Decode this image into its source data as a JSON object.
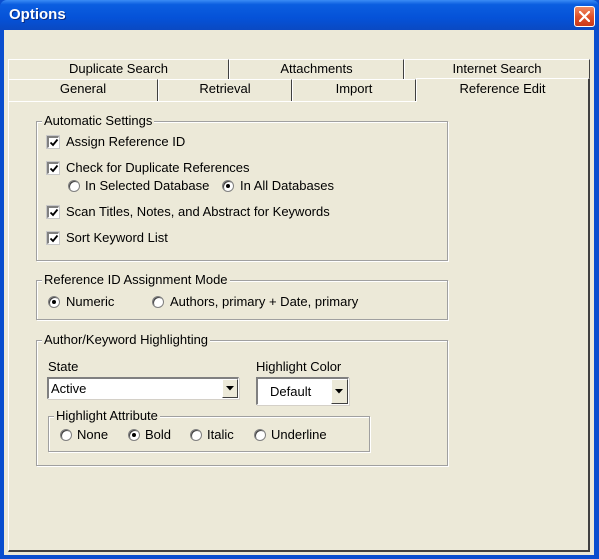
{
  "window": {
    "title": "Options",
    "accent": "#0552d8",
    "close_icon": "close-icon"
  },
  "tabs": {
    "row_back": [
      "Duplicate Search",
      "Attachments",
      "Internet Search"
    ],
    "row_front": [
      "General",
      "Retrieval",
      "Import",
      "Reference Edit"
    ],
    "active": "Reference Edit"
  },
  "automatic_settings": {
    "label": "Automatic Settings",
    "assign_reference_id": {
      "label": "Assign Reference ID",
      "checked": true
    },
    "check_duplicates": {
      "label": "Check for Duplicate References",
      "checked": true
    },
    "in_selected_db": {
      "label": "In Selected Database",
      "selected": false
    },
    "in_all_db": {
      "label": "In All Databases",
      "selected": true
    },
    "scan_titles": {
      "label": "Scan Titles, Notes, and Abstract for Keywords",
      "checked": true
    },
    "sort_keyword": {
      "label": "Sort Keyword List",
      "checked": true
    }
  },
  "ref_id_mode": {
    "label": "Reference ID Assignment Mode",
    "numeric": {
      "label": "Numeric",
      "selected": true
    },
    "authors": {
      "label": "Authors, primary + Date, primary",
      "selected": false
    }
  },
  "highlighting": {
    "label": "Author/Keyword Highlighting",
    "state_label": "State",
    "state_value": "Active",
    "color_label": "Highlight Color",
    "color_value": "Default",
    "attribute": {
      "label": "Highlight Attribute",
      "none": {
        "label": "None",
        "selected": false
      },
      "bold": {
        "label": "Bold",
        "selected": true
      },
      "italic": {
        "label": "Italic",
        "selected": false
      },
      "underline": {
        "label": "Underline",
        "selected": false
      }
    }
  }
}
